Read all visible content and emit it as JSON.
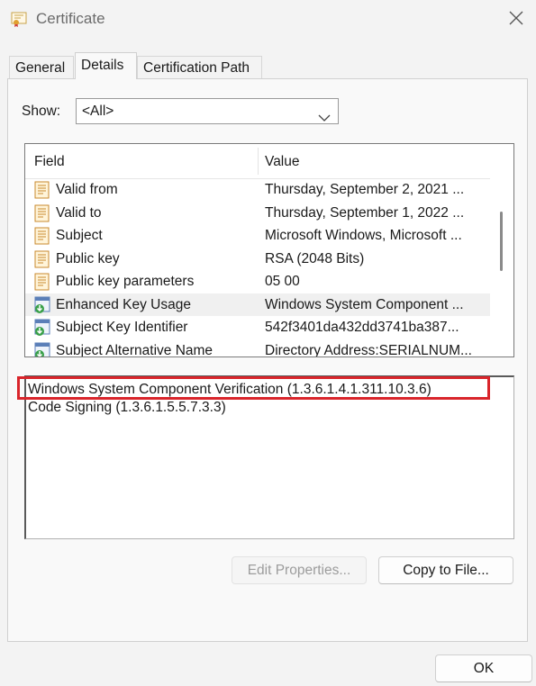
{
  "window": {
    "title": "Certificate"
  },
  "tabs": [
    {
      "label": "General"
    },
    {
      "label": "Details"
    },
    {
      "label": "Certification Path"
    }
  ],
  "show": {
    "label": "Show:",
    "selected": "<All>"
  },
  "list": {
    "headers": {
      "field": "Field",
      "value": "Value"
    },
    "rows": [
      {
        "field": "Valid from",
        "value": "Thursday, September 2, 2021 ...",
        "icon": "certificate-field-icon"
      },
      {
        "field": "Valid to",
        "value": "Thursday, September 1, 2022 ...",
        "icon": "certificate-field-icon"
      },
      {
        "field": "Subject",
        "value": "Microsoft Windows, Microsoft ...",
        "icon": "certificate-field-icon"
      },
      {
        "field": "Public key",
        "value": "RSA (2048 Bits)",
        "icon": "certificate-field-icon"
      },
      {
        "field": "Public key parameters",
        "value": "05 00",
        "icon": "certificate-field-icon"
      },
      {
        "field": "Enhanced Key Usage",
        "value": "Windows System Component ...",
        "icon": "extension-icon"
      },
      {
        "field": "Subject Key Identifier",
        "value": "542f3401da432dd3741ba387...",
        "icon": "extension-icon"
      },
      {
        "field": "Subject Alternative Name",
        "value": "Directory Address:SERIALNUM...",
        "icon": "extension-icon"
      }
    ],
    "selected_index": 5
  },
  "detail": {
    "lines": [
      "Windows System Component Verification (1.3.6.1.4.1.311.10.3.6)",
      "Code Signing (1.3.6.1.5.5.7.3.3)"
    ]
  },
  "buttons": {
    "edit_properties": "Edit Properties...",
    "copy_to_file": "Copy to File...",
    "ok": "OK"
  },
  "colors": {
    "highlight_border": "#d9252b",
    "selected_row": "#f0f0f0",
    "window_bg": "#f3f3f3"
  }
}
